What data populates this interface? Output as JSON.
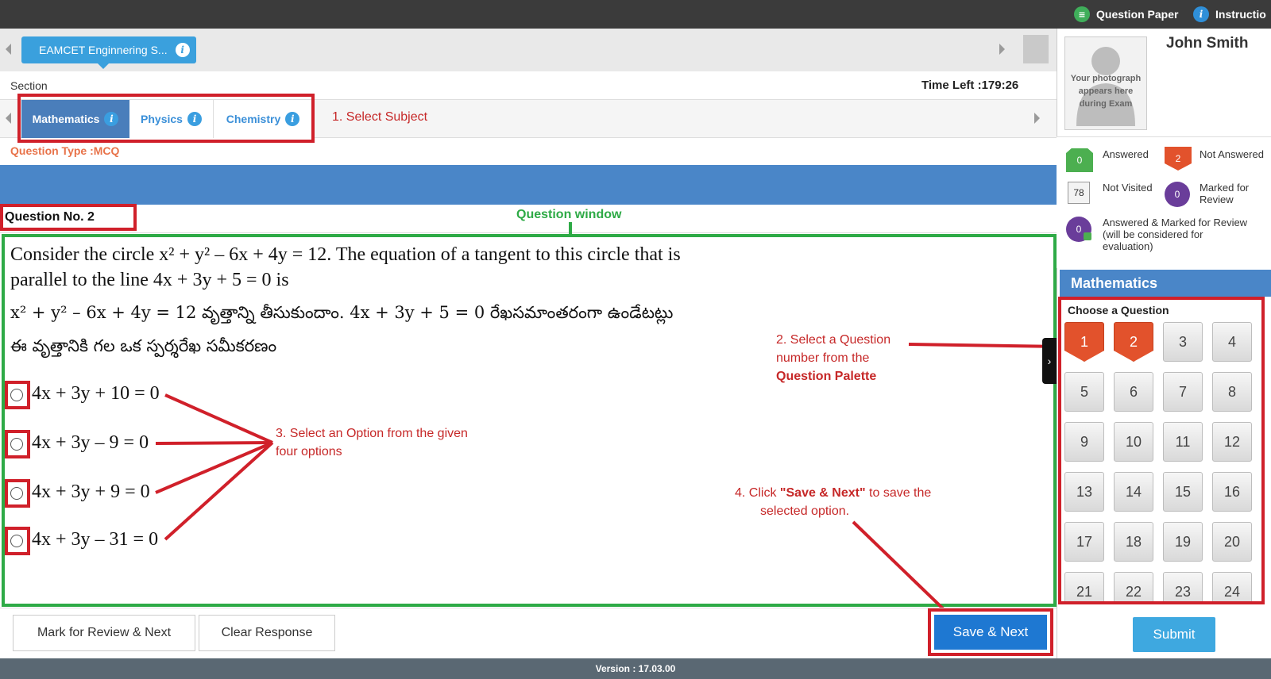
{
  "topbar": {
    "question_paper": "Question Paper",
    "instructions": "Instructio"
  },
  "exam_tab": {
    "label": "EAMCET Enginnering S..."
  },
  "section": {
    "label": "Section",
    "time_left": "Time Left :179:26"
  },
  "subjects": [
    {
      "label": "Mathematics",
      "active": true
    },
    {
      "label": "Physics",
      "active": false
    },
    {
      "label": "Chemistry",
      "active": false
    }
  ],
  "annotations": {
    "select_subject": "1. Select Subject",
    "question_window": "Question window",
    "select_question_1": "2. Select a Question",
    "select_question_2": "number from the",
    "select_question_3": "Question Palette",
    "select_option_1": "3. Select an Option from the given",
    "select_option_2": "four options",
    "save_next_1_pre": "4.   Click ",
    "save_next_1_bold": "\"Save & Next\"",
    "save_next_1_post": " to save the",
    "save_next_2": "selected option."
  },
  "question": {
    "type_label": "Question Type :MCQ",
    "number_label": "Question No. 2",
    "text_line1": "Consider the circle x² + y² – 6x + 4y = 12. The equation of a tangent to this circle that is",
    "text_line2": "parallel to the line 4x + 3y + 5 = 0 is",
    "telugu_line1": "x² + y² – 6x + 4y = 12 వృత్తాన్ని తీసుకుందాం. 4x + 3y + 5 = 0 రేఖసమాంతరంగా ఉండేటట్లు",
    "telugu_line2": "ఈ వృత్తానికి గల ఒక స్పర్శరేఖ సమీకరణం",
    "options": [
      "4x + 3y + 10 = 0",
      "4x + 3y – 9 = 0",
      "4x + 3y + 9 = 0",
      "4x + 3y – 31 = 0"
    ]
  },
  "candidate": {
    "name": "John Smith",
    "photo_text": "Your photograph appears here during Exam"
  },
  "legend": {
    "answered": {
      "count": "0",
      "label": "Answered"
    },
    "not_answered": {
      "count": "2",
      "label": "Not Answered"
    },
    "not_visited": {
      "count": "78",
      "label": "Not Visited"
    },
    "marked": {
      "count": "0",
      "label_1": "Marked for",
      "label_2": "Review"
    },
    "answered_marked": {
      "count": "0",
      "label_1": "Answered & Marked for Review",
      "label_2": "(will be considered for",
      "label_3": "evaluation)"
    }
  },
  "palette": {
    "subject": "Mathematics",
    "choose_label": "Choose a Question",
    "questions": [
      {
        "n": "1",
        "status": "not-answered"
      },
      {
        "n": "2",
        "status": "not-answered"
      },
      {
        "n": "3",
        "status": "not-visited"
      },
      {
        "n": "4",
        "status": "not-visited"
      },
      {
        "n": "5",
        "status": "not-visited"
      },
      {
        "n": "6",
        "status": "not-visited"
      },
      {
        "n": "7",
        "status": "not-visited"
      },
      {
        "n": "8",
        "status": "not-visited"
      },
      {
        "n": "9",
        "status": "not-visited"
      },
      {
        "n": "10",
        "status": "not-visited"
      },
      {
        "n": "11",
        "status": "not-visited"
      },
      {
        "n": "12",
        "status": "not-visited"
      },
      {
        "n": "13",
        "status": "not-visited"
      },
      {
        "n": "14",
        "status": "not-visited"
      },
      {
        "n": "15",
        "status": "not-visited"
      },
      {
        "n": "16",
        "status": "not-visited"
      },
      {
        "n": "17",
        "status": "not-visited"
      },
      {
        "n": "18",
        "status": "not-visited"
      },
      {
        "n": "19",
        "status": "not-visited"
      },
      {
        "n": "20",
        "status": "not-visited"
      },
      {
        "n": "21",
        "status": "not-visited"
      },
      {
        "n": "22",
        "status": "not-visited"
      },
      {
        "n": "23",
        "status": "not-visited"
      },
      {
        "n": "24",
        "status": "not-visited"
      }
    ]
  },
  "buttons": {
    "mark_review": "Mark for Review & Next",
    "clear": "Clear Response",
    "save_next": "Save & Next",
    "submit": "Submit"
  },
  "footer": {
    "version": "Version : 17.03.00"
  },
  "colors": {
    "annotation_red": "#d0202a",
    "annotation_green": "#2eaa46",
    "header_blue": "#4a86c8",
    "not_answered": "#e2522c",
    "answered": "#4caf50",
    "marked": "#6a3d9a"
  }
}
